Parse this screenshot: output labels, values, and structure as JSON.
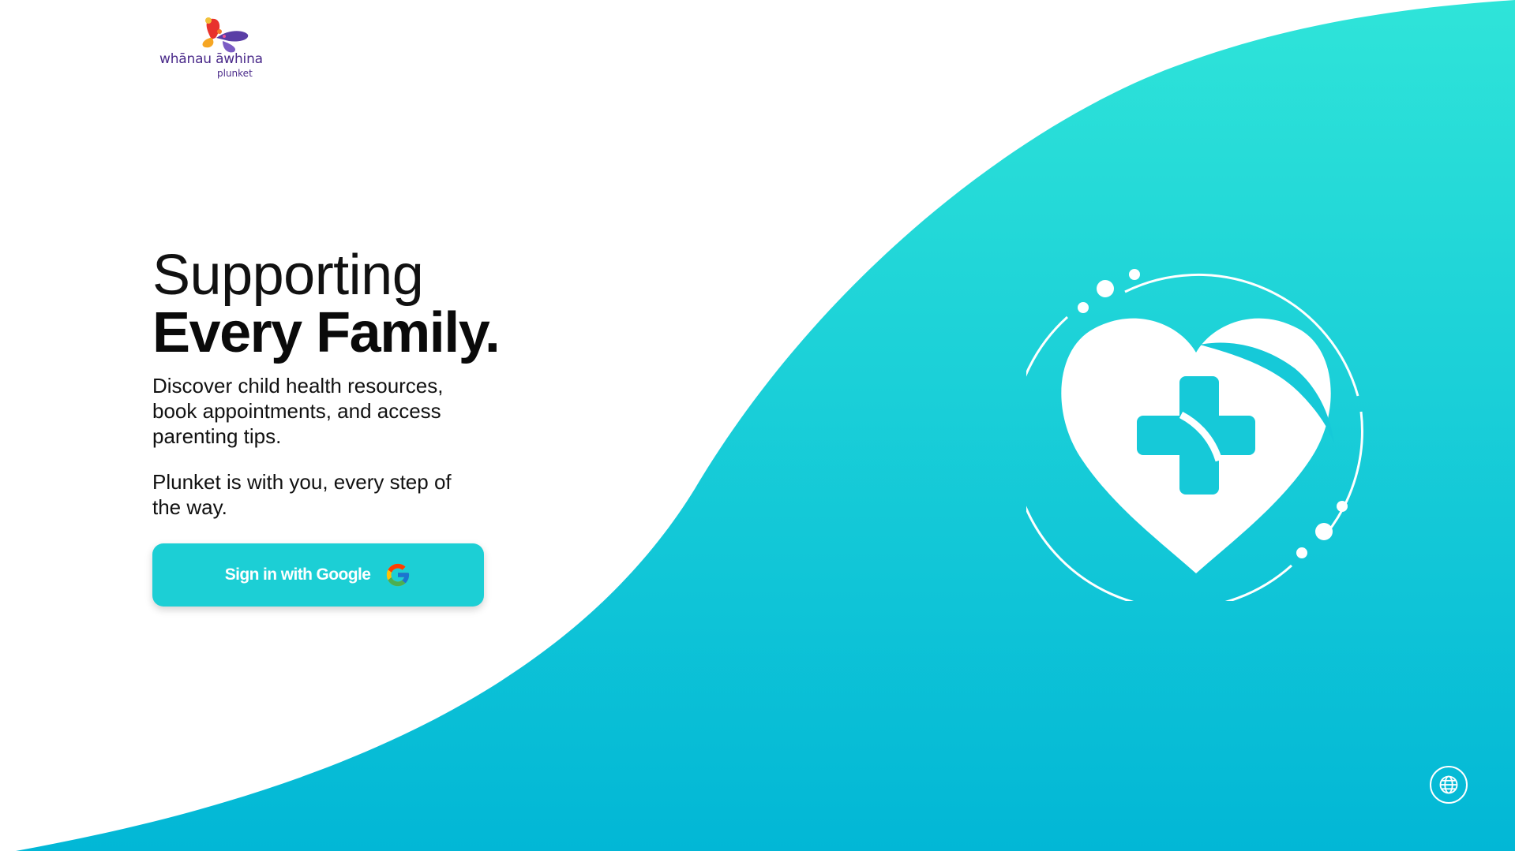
{
  "brand": {
    "name": "whānau āwhina",
    "sub": "plunket"
  },
  "hero": {
    "headline_light": "Supporting",
    "headline_bold": "Every Family.",
    "description": "Discover child health resources, book appointments, and access parenting tips.",
    "tagline": "Plunket is with you, every step of the way."
  },
  "signin": {
    "label": "Sign in with Google",
    "icon": "google-g-icon"
  },
  "language_button": {
    "icon": "globe-icon"
  },
  "colors": {
    "accent": "#1ccfd5",
    "wave_top": "#2ee3d9",
    "wave_bottom": "#02b8d6",
    "brand_purple": "#4a2a8a"
  }
}
